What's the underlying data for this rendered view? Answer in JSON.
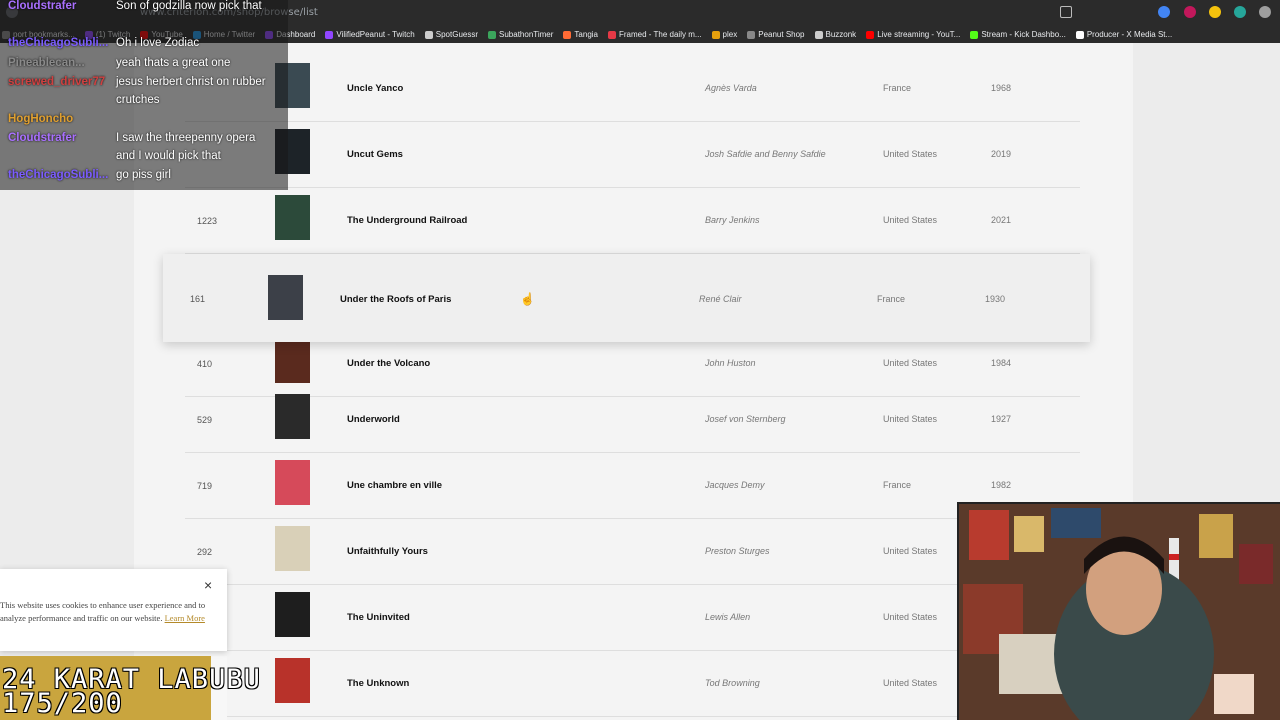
{
  "browser": {
    "url": "www.criterion.com/shop/browse/list",
    "bookmarks": [
      {
        "label": "port bookmarks...",
        "color": "#888888"
      },
      {
        "label": "(1) Twitch",
        "color": "#9146ff"
      },
      {
        "label": "YouTube",
        "color": "#ff0000"
      },
      {
        "label": "Home / Twitter",
        "color": "#1d9bf0"
      },
      {
        "label": "Dashboard",
        "color": "#9146ff"
      },
      {
        "label": "VilifiedPeanut - Twitch",
        "color": "#9146ff"
      },
      {
        "label": "SpotGuessr",
        "color": "#cccccc"
      },
      {
        "label": "SubathonTimer",
        "color": "#3ba55c"
      },
      {
        "label": "Tangia",
        "color": "#ff6b35"
      },
      {
        "label": "Framed - The daily m...",
        "color": "#e63946"
      },
      {
        "label": "plex",
        "color": "#e5a00d"
      },
      {
        "label": "Peanut Shop",
        "color": "#888888"
      },
      {
        "label": "Buzzonk",
        "color": "#cccccc"
      },
      {
        "label": "Live streaming - YouT...",
        "color": "#ff0000"
      },
      {
        "label": "Stream - Kick Dashbo...",
        "color": "#53fc18"
      },
      {
        "label": "Producer - X Media St...",
        "color": "#ffffff"
      }
    ]
  },
  "films": [
    {
      "num": "",
      "title": "Uncle Yanco",
      "director": "Agnès Varda",
      "country": "France",
      "year": "1968",
      "poster": "#3a4a52"
    },
    {
      "num": "",
      "title": "Uncut Gems",
      "director": "Josh Safdie and Benny Safdie",
      "country": "United States",
      "year": "2019",
      "poster": "#1d2328"
    },
    {
      "num": "1223",
      "title": "The Underground Railroad",
      "director": "Barry Jenkins",
      "country": "United States",
      "year": "2021",
      "poster": "#2c4a3a"
    },
    {
      "num": "161",
      "title": "Under the Roofs of Paris",
      "director": "René Clair",
      "country": "France",
      "year": "1930",
      "poster": "#3c4048",
      "highlighted": true
    },
    {
      "num": "410",
      "title": "Under the Volcano",
      "director": "John Huston",
      "country": "United States",
      "year": "1984",
      "poster": "#5a2a1e"
    },
    {
      "num": "529",
      "title": "Underworld",
      "director": "Josef von Sternberg",
      "country": "United States",
      "year": "1927",
      "poster": "#2a2a2a"
    },
    {
      "num": "719",
      "title": "Une chambre en ville",
      "director": "Jacques Demy",
      "country": "France",
      "year": "1982",
      "poster": "#d64a5a"
    },
    {
      "num": "292",
      "title": "Unfaithfully Yours",
      "director": "Preston Sturges",
      "country": "United States",
      "year": "",
      "poster": "#d9d0b8"
    },
    {
      "num": "",
      "title": "The Uninvited",
      "director": "Lewis Allen",
      "country": "United States",
      "year": "",
      "poster": "#1e1e1e"
    },
    {
      "num": "",
      "title": "The Unknown",
      "director": "Tod Browning",
      "country": "United States",
      "year": "",
      "poster": "#b8322a"
    }
  ],
  "chat": [
    {
      "user": "Cloudstrafer",
      "color": "#a970ff",
      "text": "Son of godzilla now pick that"
    },
    {
      "user": "theChicagoSubli...",
      "color": "#7b5cff",
      "text": "Oh i love Zodiac"
    },
    {
      "user": "Pineablecan...",
      "color": "#8a8a8a",
      "text": "yeah thats a great one"
    },
    {
      "user": "screwed_driver77",
      "color": "#d04040",
      "text": "jesus herbert christ on rubber"
    },
    {
      "user": "",
      "color": "#ffffff",
      "text": "crutches"
    },
    {
      "user": "HogHoncho",
      "color": "#e0a030",
      "text": ""
    },
    {
      "user": "Cloudstrafer",
      "color": "#a970ff",
      "text": "I saw the threepenny opera"
    },
    {
      "user": "",
      "color": "#ffffff",
      "text": "and I would pick that"
    },
    {
      "user": "theChicagoSubli...",
      "color": "#7b5cff",
      "text": "go piss girl"
    }
  ],
  "cookie": {
    "text": "This website uses cookies to enhance user experience and to analyze performance and traffic on our website.",
    "link": "Learn More",
    "close": "×"
  },
  "overlay": {
    "line1": "24 KARAT LABUBU",
    "line2": "175/200"
  }
}
